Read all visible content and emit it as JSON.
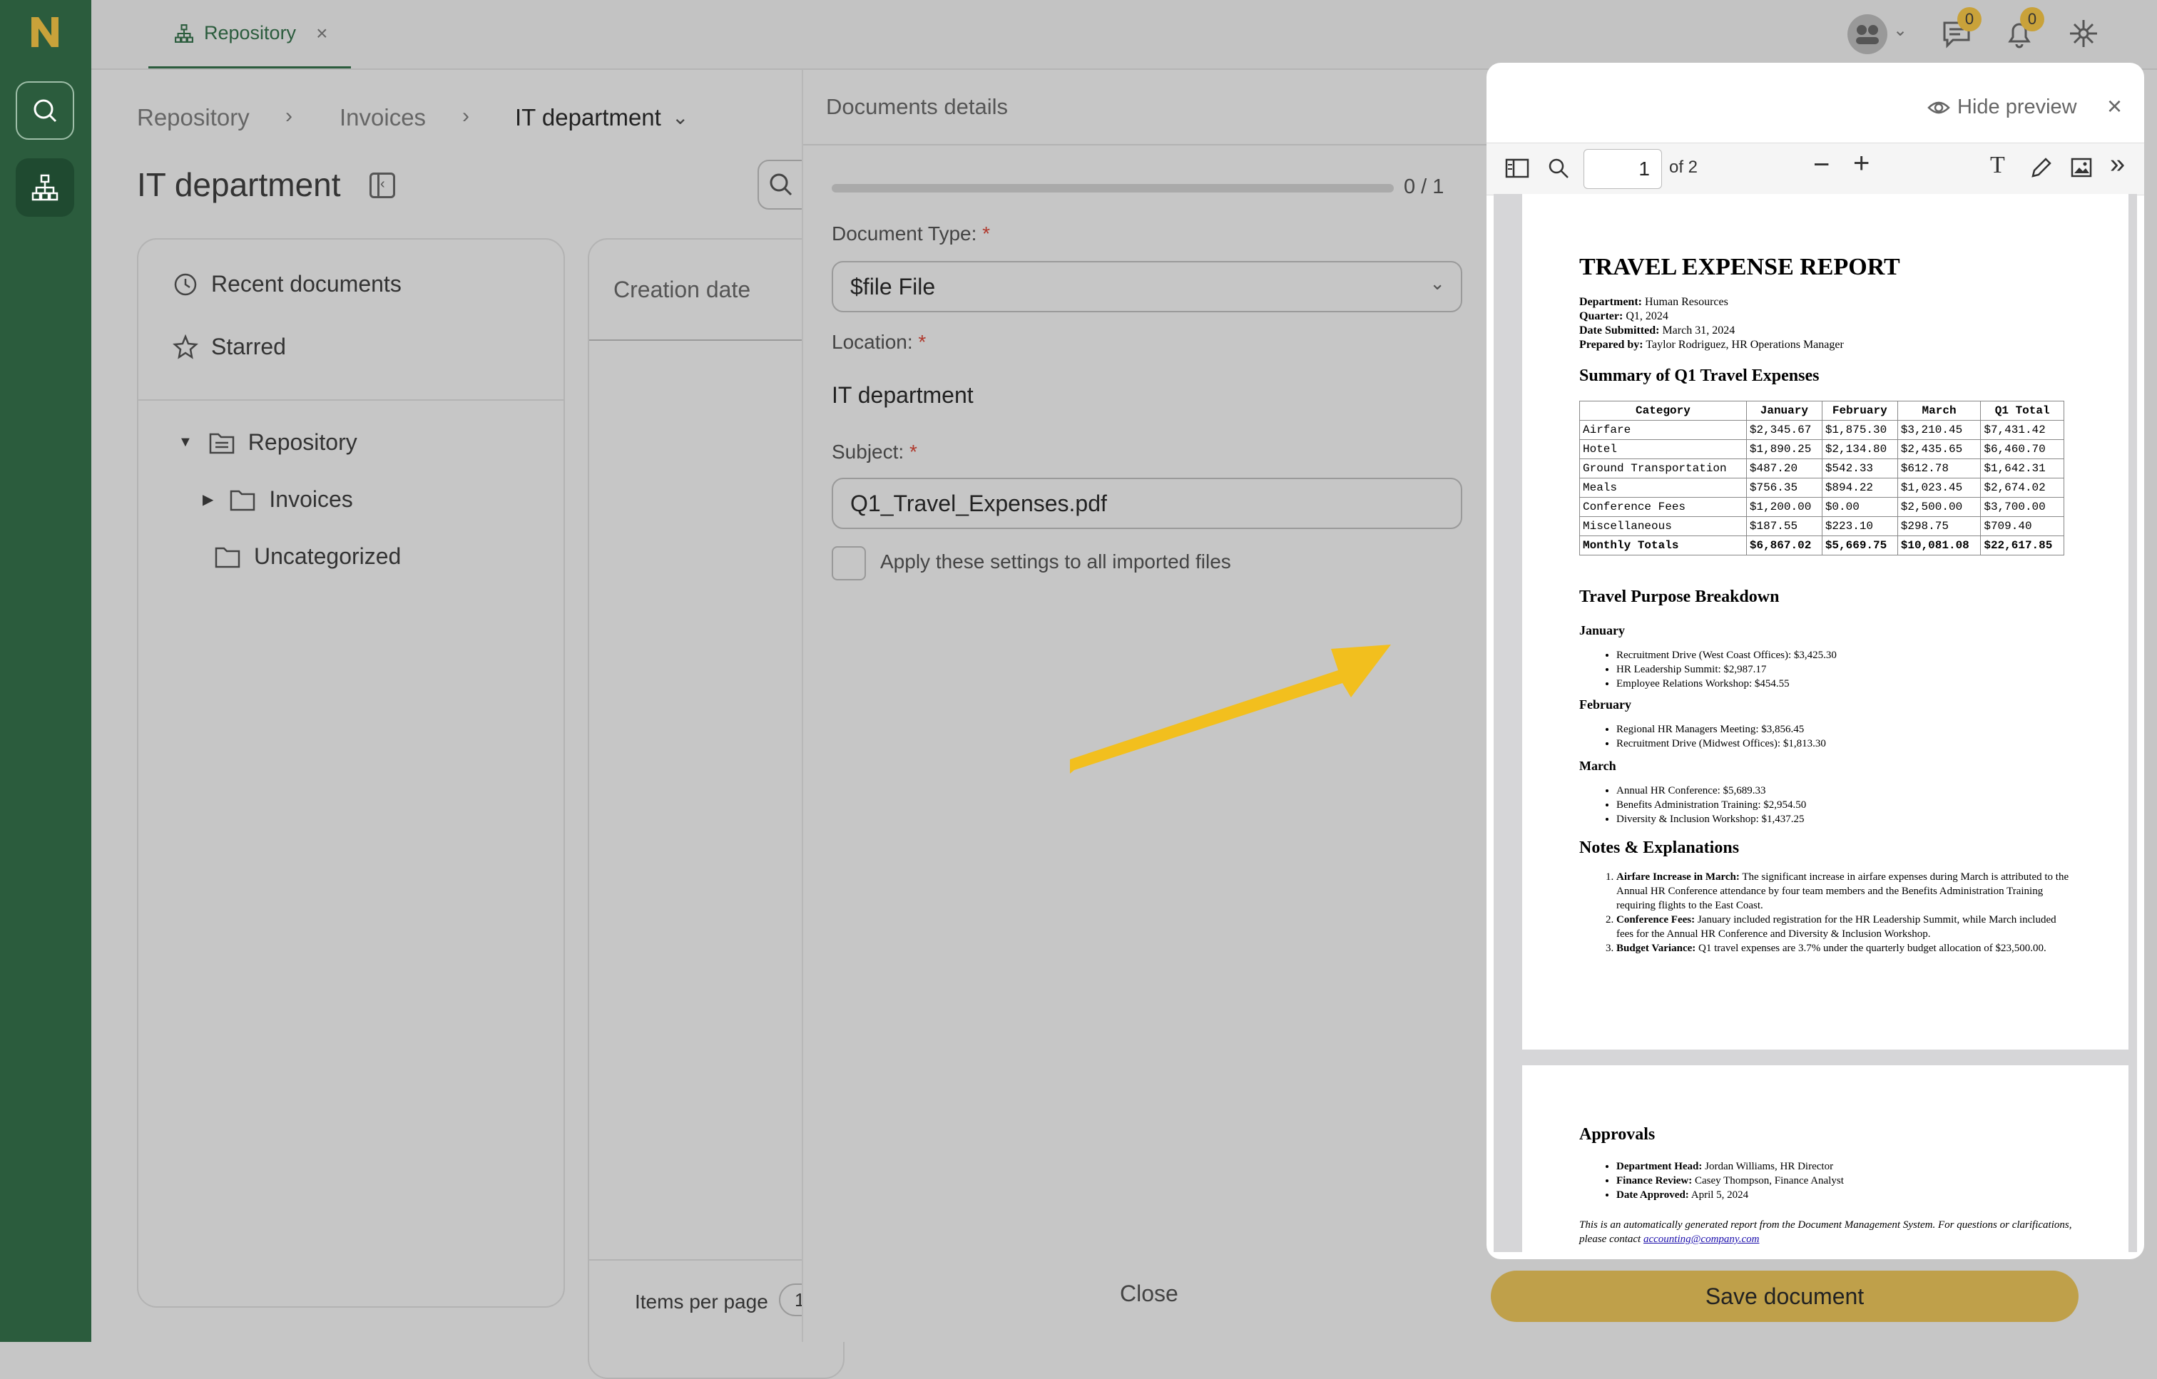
{
  "topbar": {
    "tab_label": "Repository",
    "chat_badge": "0",
    "bell_badge": "0"
  },
  "breadcrumb": {
    "items": [
      "Repository",
      "Invoices"
    ],
    "current": "IT department"
  },
  "page_title": "IT department",
  "left_nav": {
    "recent": "Recent documents",
    "starred": "Starred",
    "tree": {
      "root": "Repository",
      "child1": "Invoices",
      "child2": "Uncategorized"
    }
  },
  "content": {
    "column_header": "Creation date",
    "items_per_page_label": "Items per page",
    "items_per_page_value": "1"
  },
  "details": {
    "title": "Documents details",
    "progress_text": "0 / 1",
    "progress_fraction": 0,
    "doc_type_label": "Document Type:",
    "doc_type_value": "$file File",
    "location_label": "Location:",
    "location_value": "IT department",
    "subject_label": "Subject:",
    "subject_value": "Q1_Travel_Expenses.pdf",
    "apply_all_label": "Apply these settings to all imported files",
    "close_label": "Close",
    "required_mark": "*"
  },
  "preview": {
    "hide_label": "Hide preview",
    "page_input": "1",
    "page_total": "of 2",
    "save_label": "Save document"
  },
  "document": {
    "title": "TRAVEL EXPENSE REPORT",
    "meta": [
      {
        "k": "Department:",
        "v": "Human Resources"
      },
      {
        "k": "Quarter:",
        "v": "Q1, 2024"
      },
      {
        "k": "Date Submitted:",
        "v": "March 31, 2024"
      },
      {
        "k": "Prepared by:",
        "v": "Taylor Rodriguez, HR Operations Manager"
      }
    ],
    "summary_heading": "Summary of Q1 Travel Expenses",
    "table": {
      "headers": [
        "Category",
        "January",
        "February",
        "March",
        "Q1 Total"
      ],
      "rows": [
        [
          "Airfare",
          "$2,345.67",
          "$1,875.30",
          "$3,210.45",
          "$7,431.42"
        ],
        [
          "Hotel",
          "$1,890.25",
          "$2,134.80",
          "$2,435.65",
          "$6,460.70"
        ],
        [
          "Ground Transportation",
          "$487.20",
          "$542.33",
          "$612.78",
          "$1,642.31"
        ],
        [
          "Meals",
          "$756.35",
          "$894.22",
          "$1,023.45",
          "$2,674.02"
        ],
        [
          "Conference Fees",
          "$1,200.00",
          "$0.00",
          "$2,500.00",
          "$3,700.00"
        ],
        [
          "Miscellaneous",
          "$187.55",
          "$223.10",
          "$298.75",
          "$709.40"
        ]
      ],
      "totals": [
        "Monthly Totals",
        "$6,867.02",
        "$5,669.75",
        "$10,081.08",
        "$22,617.85"
      ]
    },
    "purpose_heading": "Travel Purpose Breakdown",
    "months": [
      {
        "name": "January",
        "items": [
          "Recruitment Drive (West Coast Offices): $3,425.30",
          "HR Leadership Summit: $2,987.17",
          "Employee Relations Workshop: $454.55"
        ]
      },
      {
        "name": "February",
        "items": [
          "Regional HR Managers Meeting: $3,856.45",
          "Recruitment Drive (Midwest Offices): $1,813.30"
        ]
      },
      {
        "name": "March",
        "items": [
          "Annual HR Conference: $5,689.33",
          "Benefits Administration Training: $2,954.50",
          "Diversity & Inclusion Workshop: $1,437.25"
        ]
      }
    ],
    "notes_heading": "Notes & Explanations",
    "notes": [
      {
        "k": "Airfare Increase in March:",
        "v": "The significant increase in airfare expenses during March is attributed to the Annual HR Conference attendance by four team members and the Benefits Administration Training requiring flights to the East Coast."
      },
      {
        "k": "Conference Fees:",
        "v": "January included registration for the HR Leadership Summit, while March included fees for the Annual HR Conference and Diversity & Inclusion Workshop."
      },
      {
        "k": "Budget Variance:",
        "v": "Q1 travel expenses are 3.7% under the quarterly budget allocation of $23,500.00."
      }
    ],
    "approvals_heading": "Approvals",
    "approvals": [
      {
        "k": "Department Head:",
        "v": "Jordan Williams, HR Director"
      },
      {
        "k": "Finance Review:",
        "v": "Casey Thompson, Finance Analyst"
      },
      {
        "k": "Date Approved:",
        "v": "April 5, 2024"
      }
    ],
    "footer_text": "This is an automatically generated report from the Document Management System. For questions or clarifications, please contact",
    "footer_email": "accounting@company.com"
  },
  "colors": {
    "sidebar": "#2b5c3d",
    "accent_gold": "#bfa04a",
    "arrow": "#f2bf1e"
  }
}
